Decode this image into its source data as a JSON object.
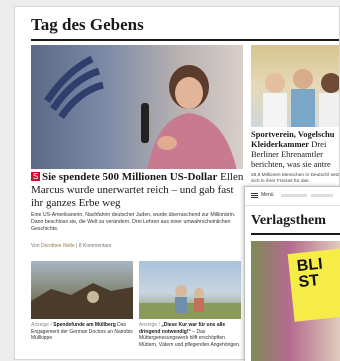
{
  "section": {
    "title": "Tag des Gebens"
  },
  "lead": {
    "marker": "S",
    "headline_strong": "Sie spendete 500 Millionen US-Dollar",
    "headline_rest": " Ellen Marcus wurde unerwartet reich – und gab fast ihr ganzes Erbe weg",
    "teaser": "Eine US-Amerikanerin, Nachfahrin deutscher Juden, wurde überraschend zur Millionärin. Dann beschloss sie, die Welt zu verändern. Drei Lehren aus einer umwahrscheinlichen Geschichte.",
    "byline_prefix": "Von ",
    "author": "Dorothee Nolte",
    "comments": " | 8 Kommentare"
  },
  "small_items": [
    {
      "tag": "Anzeige / ",
      "title": "Spendefunde am Müllberg",
      "text": " Das Engagement der German Doctors an Nairobis Müllkippe"
    },
    {
      "tag": "Anzeige / ",
      "title": "„Diese Kur war für uns alle dringend notwendig!“",
      "text": " – Das Müttergenesungswerk hilft erschöpften Müttern, Vätern und pflegenden Angehörigen."
    }
  ],
  "side": {
    "headline_strong": "Sportverein, Vogelschu Kleiderkammer",
    "headline_rest": " Drei Berliner Ehrenamtler berichten, was sie antre",
    "teaser": "28,8 Millionen Menschen in Deutschl setzen sich in ihrer Freizeit für das"
  },
  "overlay": {
    "menu_label": "Menü",
    "title": "Verlagsthem",
    "poster_text": "BLI ST"
  }
}
